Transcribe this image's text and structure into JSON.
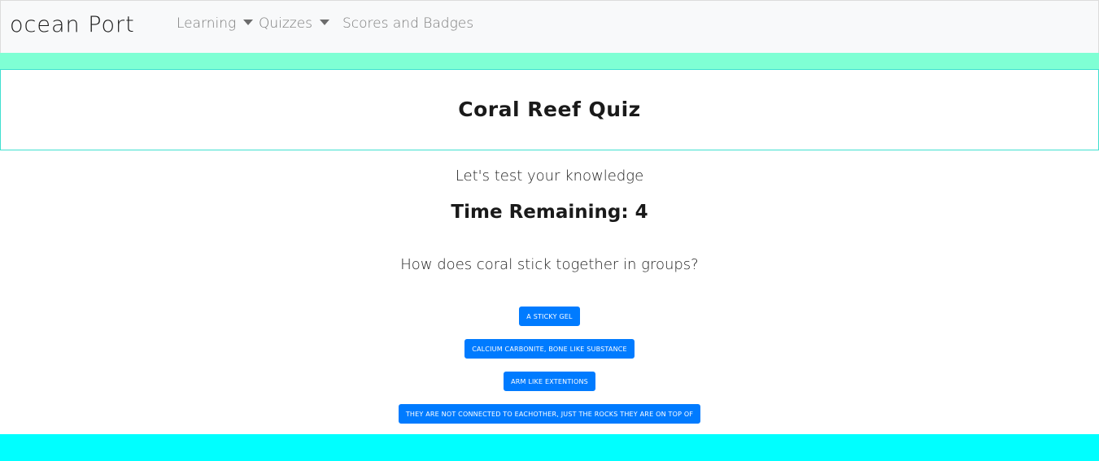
{
  "navbar": {
    "brand": "ocean Port",
    "items": [
      {
        "label": "Learning",
        "has_dropdown": true
      },
      {
        "label": "Quizzes",
        "has_dropdown": true
      },
      {
        "label": "Scores and Badges",
        "has_dropdown": false
      }
    ]
  },
  "header": {
    "title": "Coral Reef Quiz"
  },
  "quiz": {
    "subtitle": "Let's test your knowledge",
    "timer_label": "Time Remaining:",
    "timer_value": "4",
    "question": "How does coral stick together in groups?",
    "answers": [
      "A sticky gel",
      "Calcium Carbonite, bone like substance",
      "Arm like extentions",
      "they are not connected to eachother, just the rocks they are on top of"
    ]
  },
  "colors": {
    "navbar_bg": "#f8f9fa",
    "mint_band": "#7fffd4",
    "title_border": "#40e0d0",
    "button_bg": "#007bff",
    "footer_bg": "#00ffff"
  }
}
